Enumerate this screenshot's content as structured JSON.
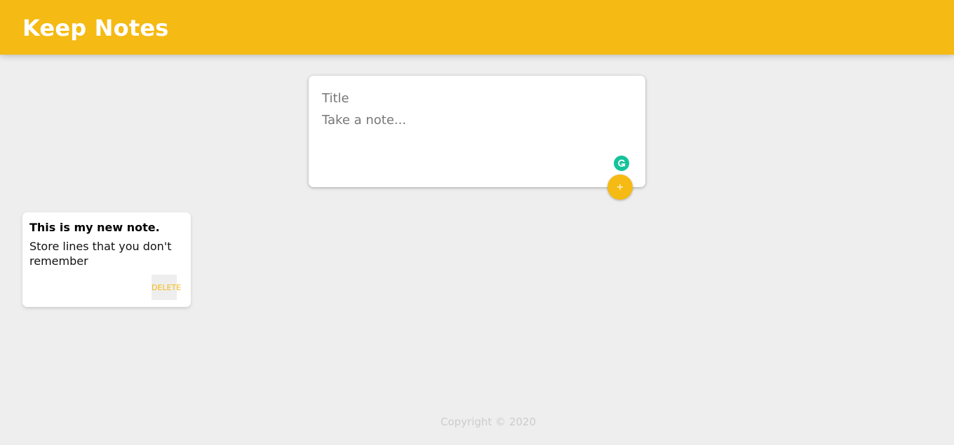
{
  "header": {
    "app_title": "Keep Notes",
    "brand_color": "#f5ba13"
  },
  "create_form": {
    "title_placeholder": "Title",
    "title_value": "",
    "content_placeholder": "Take a note...",
    "content_value": "",
    "add_button_label": "+",
    "grammarly_icon": "grammarly-icon"
  },
  "notes": [
    {
      "title": "This is my new note.",
      "content": "Store lines that you don't remember",
      "delete_label": "DELETE"
    }
  ],
  "footer": {
    "copyright": "Copyright © 2020"
  }
}
